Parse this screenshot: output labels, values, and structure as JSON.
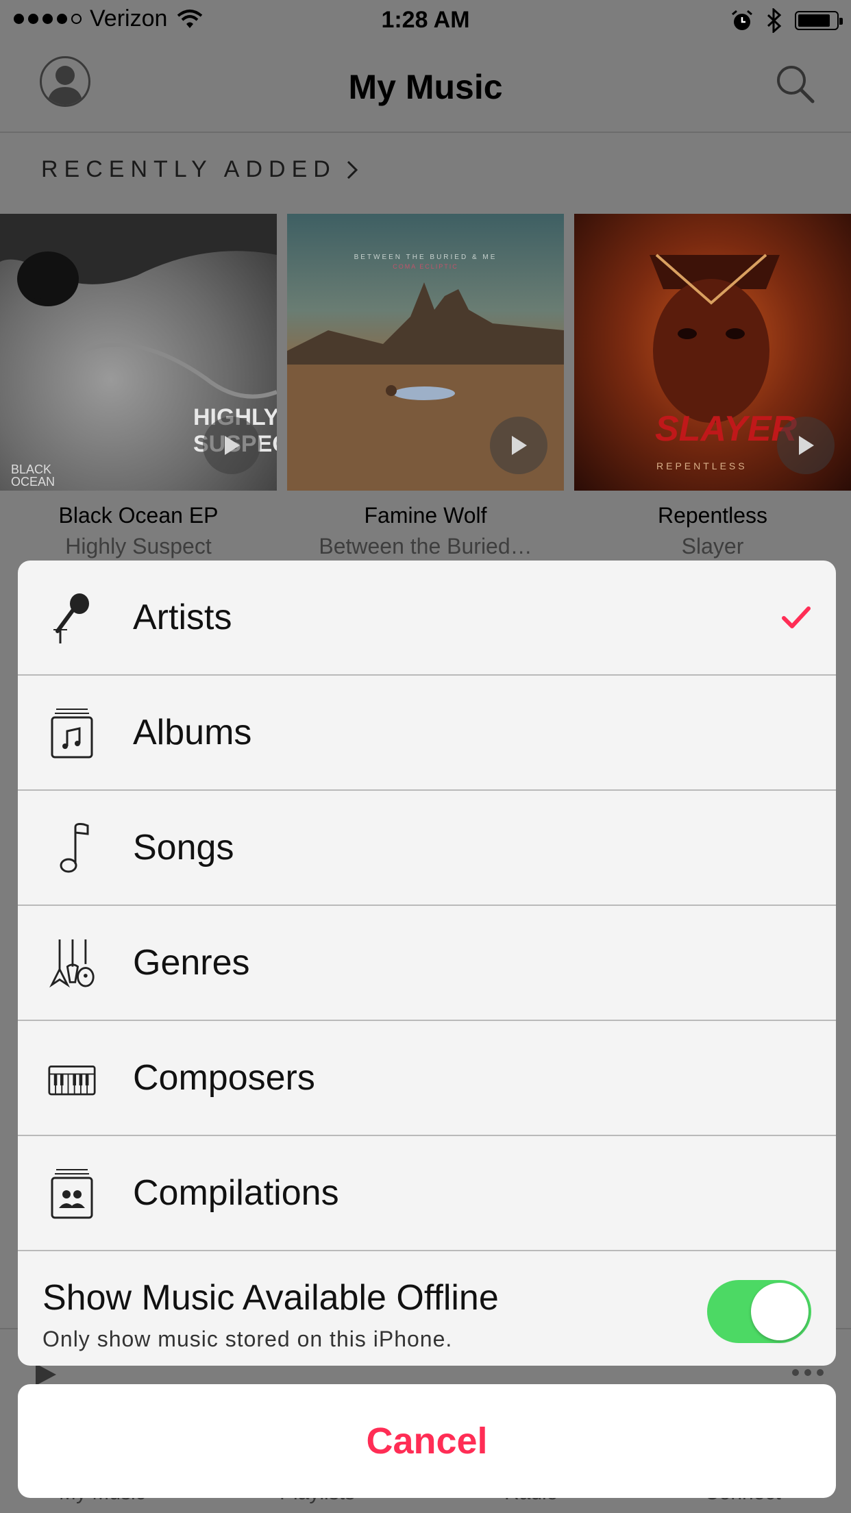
{
  "status_bar": {
    "carrier": "Verizon",
    "time": "1:28 AM",
    "signal_bars_filled": 4,
    "signal_bars_total": 5
  },
  "nav": {
    "title": "My Music",
    "profile_icon": "person-icon",
    "search_icon": "search-icon"
  },
  "recently_added": {
    "heading": "RECENTLY ADDED",
    "albums": [
      {
        "title": "Black Ocean EP",
        "artist": "Highly Suspect",
        "cover_text": "HIGHLY SUSPECT",
        "cover_corner": "BLACK OCEAN"
      },
      {
        "title": "Famine Wolf",
        "artist": "Between the Buried…",
        "cover_text": "BETWEEN THE BURIED & ME",
        "cover_sub": "COMA ECLIPTIC"
      },
      {
        "title": "Repentless",
        "artist": "Slayer",
        "cover_text": "SLAYER",
        "cover_sub": "REPENTLESS"
      }
    ]
  },
  "sheet": {
    "items": [
      {
        "label": "Artists",
        "icon": "microphone-icon",
        "selected": true
      },
      {
        "label": "Albums",
        "icon": "album-icon",
        "selected": false
      },
      {
        "label": "Songs",
        "icon": "music-note-icon",
        "selected": false
      },
      {
        "label": "Genres",
        "icon": "guitars-icon",
        "selected": false
      },
      {
        "label": "Composers",
        "icon": "piano-icon",
        "selected": false
      },
      {
        "label": "Compilations",
        "icon": "compilation-icon",
        "selected": false
      }
    ],
    "offline": {
      "title": "Show Music Available Offline",
      "subtitle": "Only show music stored on this iPhone.",
      "enabled": true
    },
    "cancel_label": "Cancel"
  },
  "background_tabs": [
    "My Music",
    "Playlists",
    "Radio",
    "Connect"
  ],
  "colors": {
    "accent": "#ff2d55",
    "toggle_on": "#4cd964"
  }
}
